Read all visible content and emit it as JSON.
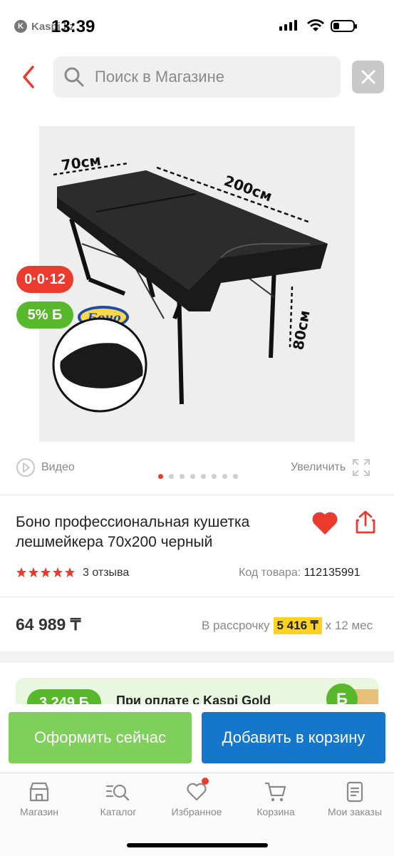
{
  "status_bar": {
    "time": "13:39",
    "back_app": "Kaspi.kz"
  },
  "search": {
    "placeholder": "Поиск в Магазине"
  },
  "product_image": {
    "labels": {
      "width": "70см",
      "length": "200см",
      "height": "80см"
    },
    "brand_logo": "Боно",
    "badge_installment": "0·0·12",
    "badge_bonus": "5% Б"
  },
  "media": {
    "video_label": "Видео",
    "zoom_label": "Увеличить",
    "slides_count": 8,
    "active_slide": 1
  },
  "product": {
    "title": "Боно профессиональная кушетка лешмейкера 70x200 черный",
    "rating": 5,
    "reviews": "3 отзыва",
    "code_label": "Код товара:",
    "code_value": "112135991",
    "favorited": true
  },
  "price": {
    "value": "64 989 ₸",
    "installment_prefix": "В рассрочку",
    "installment_amount": "5 416 ₸",
    "installment_suffix": "x 12 мес"
  },
  "promo": {
    "bonus": "3 249 Б",
    "text": "При оплате с Kaspi Gold",
    "coin": "Б"
  },
  "actions": {
    "buy_now": "Оформить сейчас",
    "add_to_cart": "Добавить в корзину"
  },
  "tabbar": [
    {
      "label": "Магазин",
      "icon": "shop-icon"
    },
    {
      "label": "Каталог",
      "icon": "catalog-icon"
    },
    {
      "label": "Избранное",
      "icon": "heart-icon",
      "badge": true
    },
    {
      "label": "Корзина",
      "icon": "cart-icon"
    },
    {
      "label": "Мои заказы",
      "icon": "orders-icon"
    }
  ],
  "colors": {
    "accent_red": "#ea3b2e",
    "green": "#56b82a",
    "blue": "#1577cb",
    "light_green": "#7fcf5b",
    "yellow": "#ffd21f"
  }
}
